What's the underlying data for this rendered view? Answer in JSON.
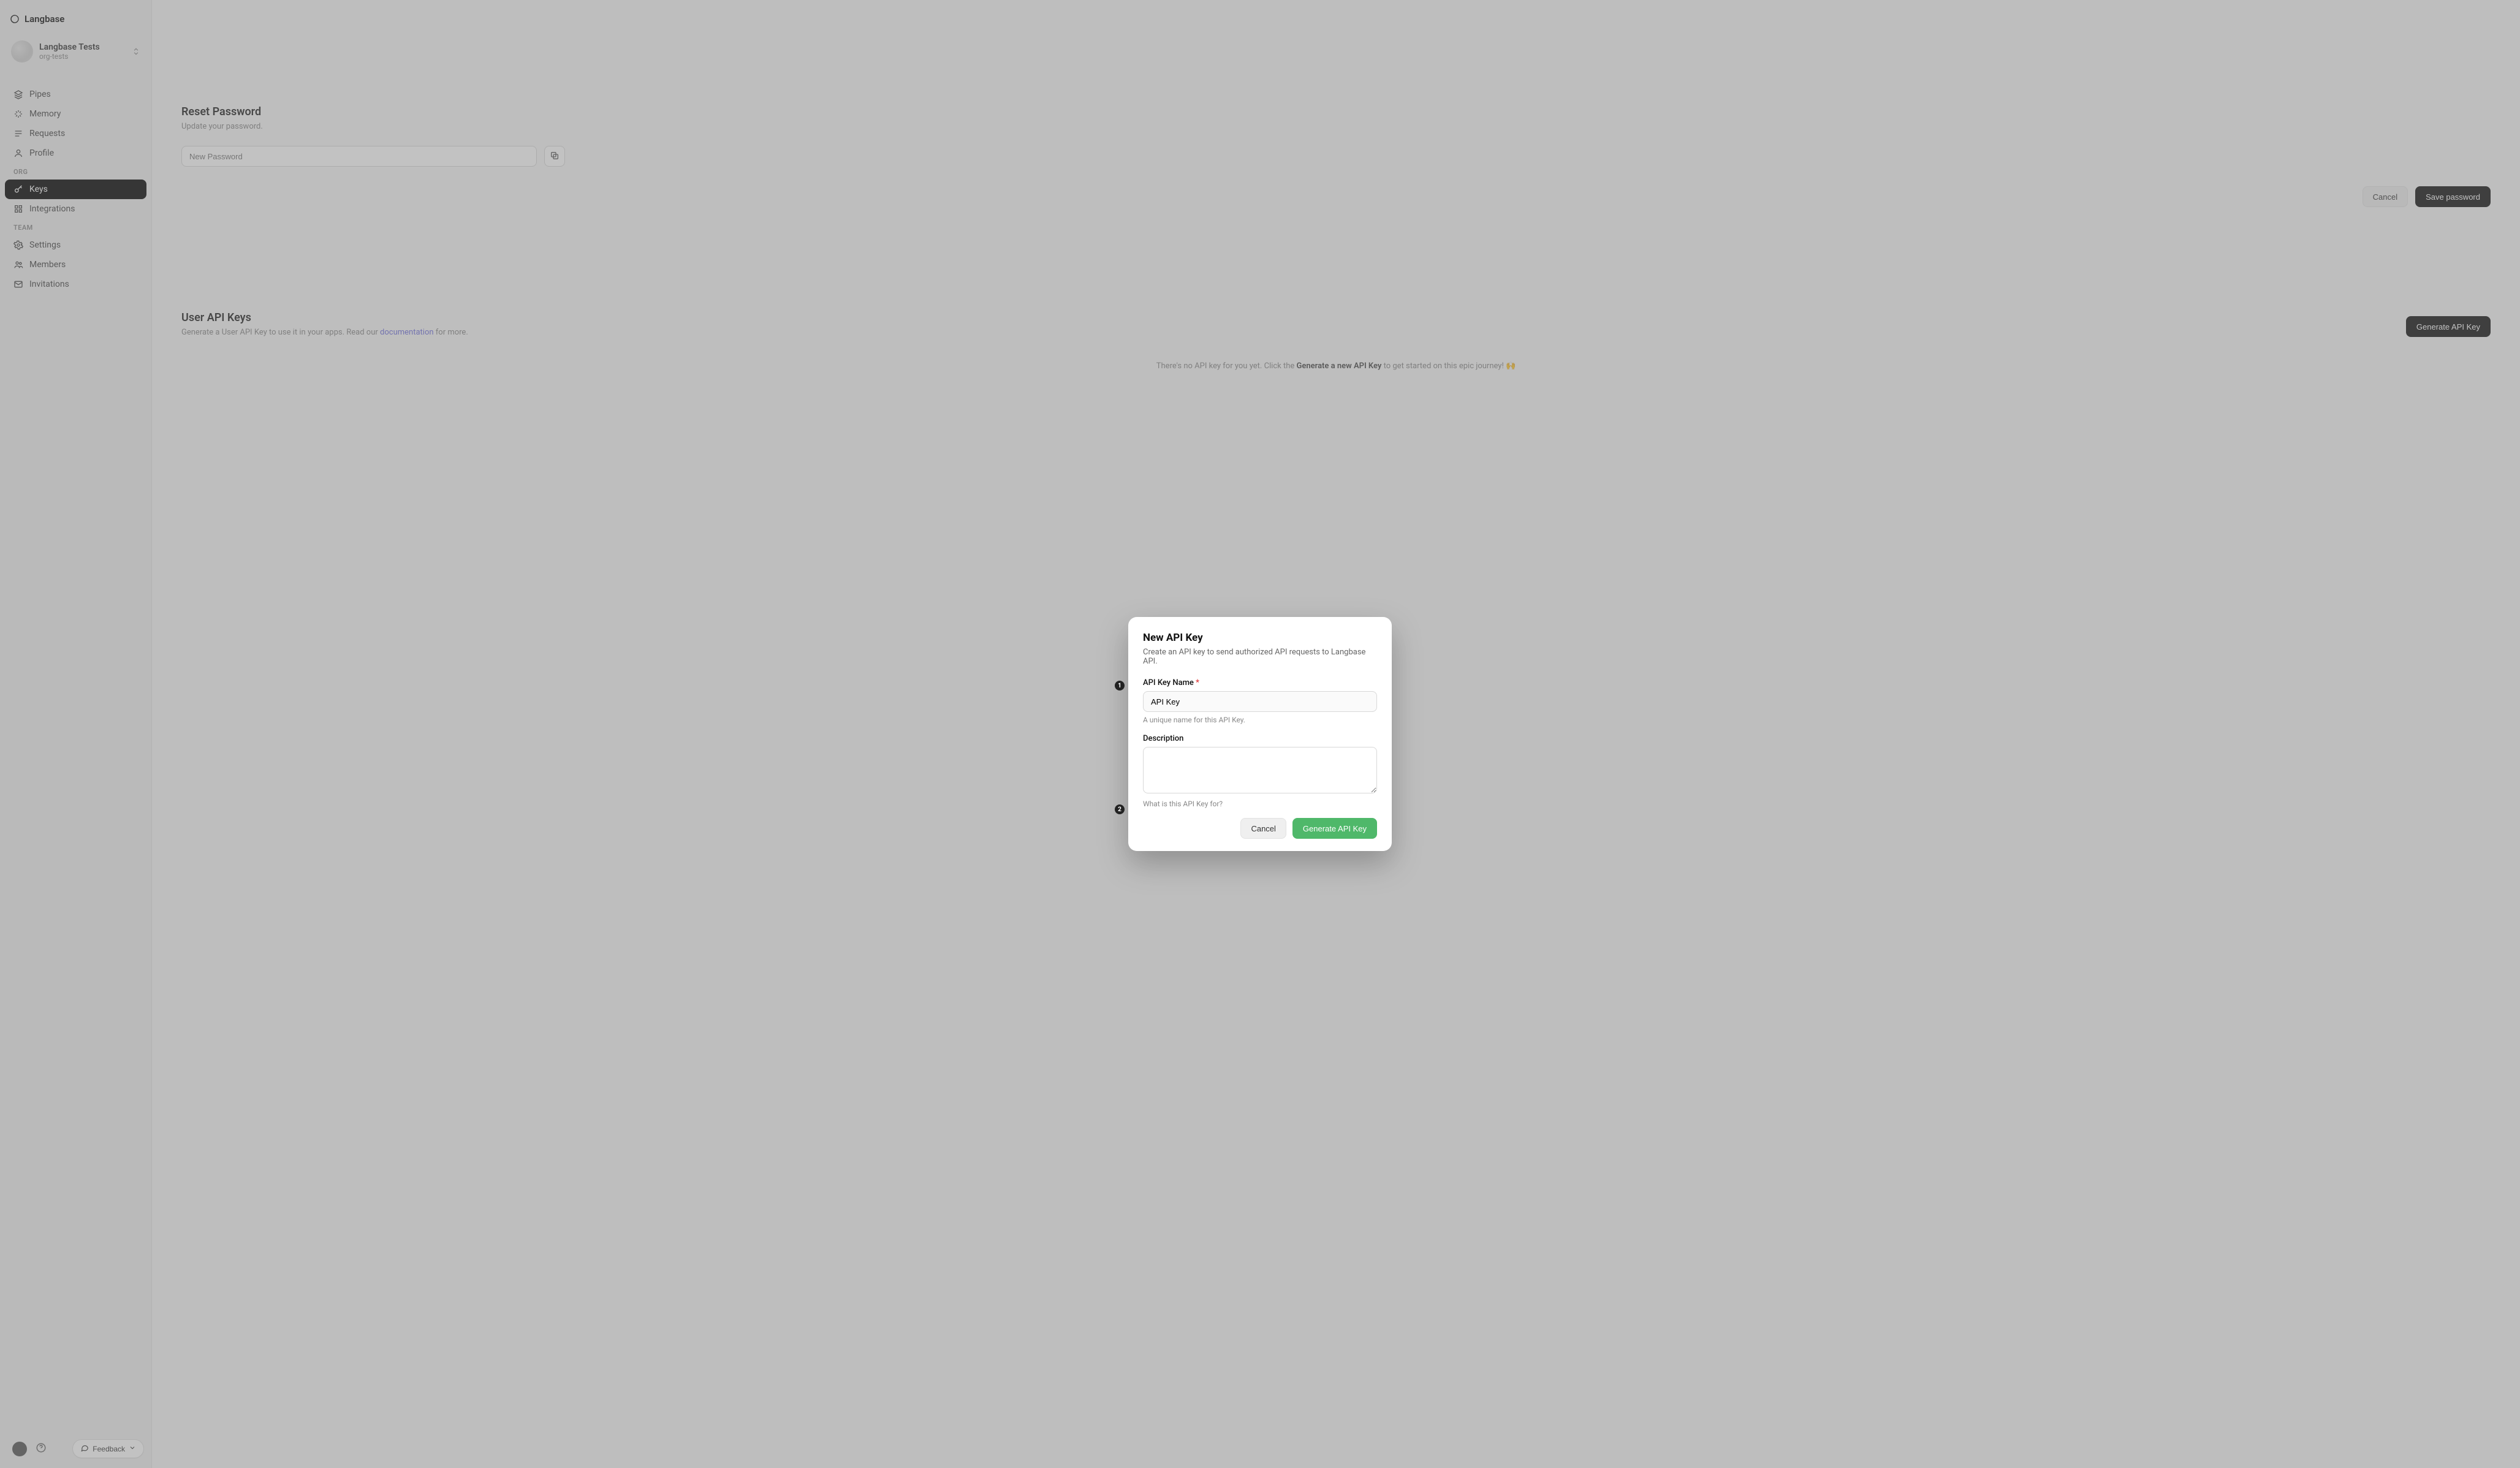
{
  "brand": {
    "name": "Langbase"
  },
  "org": {
    "title": "Langbase Tests",
    "subtitle": "org-tests"
  },
  "nav": {
    "items": [
      {
        "label": "Pipes"
      },
      {
        "label": "Memory"
      },
      {
        "label": "Requests"
      },
      {
        "label": "Profile"
      }
    ]
  },
  "navOrg": {
    "header": "ORG",
    "items": [
      {
        "label": "Keys"
      },
      {
        "label": "Integrations"
      }
    ]
  },
  "navTeam": {
    "header": "TEAM",
    "items": [
      {
        "label": "Settings"
      },
      {
        "label": "Members"
      },
      {
        "label": "Invitations"
      }
    ]
  },
  "sidebarFoot": {
    "feedback": "Feedback"
  },
  "sectionReset": {
    "title": "Reset Password",
    "subtitle": "Update your password.",
    "placeholder": "New Password",
    "cancel": "Cancel",
    "save": "Save password"
  },
  "sectionKeys": {
    "title": "User API Keys",
    "desc_pre": "Generate a User API Key ",
    "desc_mid": "to use it in your apps. Read our ",
    "desc_link": "documentation",
    "desc_post": " for more.",
    "generate": "Generate API Key",
    "empty_pre": "There's no API key for you yet. Click the ",
    "empty_strong": "Generate a new API Key",
    "empty_post": " to get started on this epic journey! 🙌"
  },
  "modal": {
    "title": "New API Key",
    "subtitle": "Create an API key to send authorized API requests to Langbase API.",
    "name_label": "API Key Name",
    "name_value": "API Key",
    "name_hint": "A unique name for this API Key.",
    "desc_label": "Description",
    "desc_hint": "What is this API Key for?",
    "cancel": "Cancel",
    "submit": "Generate API Key",
    "step1": "1",
    "step2": "2"
  }
}
